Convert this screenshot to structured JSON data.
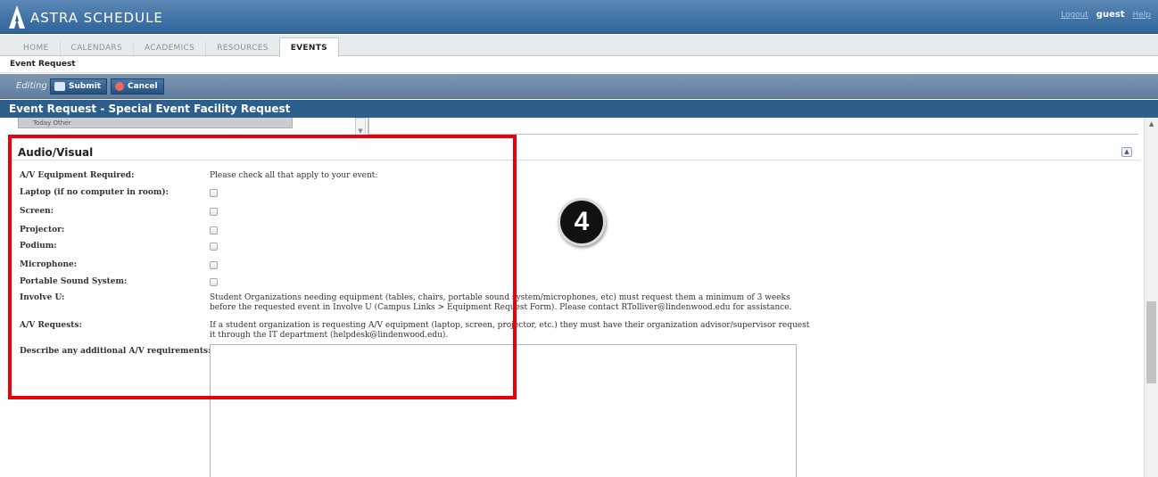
{
  "header": {
    "app_name": "ASTRA SCHEDULE",
    "logout": "Logout",
    "user": "guest",
    "help": "Help"
  },
  "nav": {
    "tabs": [
      "HOME",
      "CALENDARS",
      "ACADEMICS",
      "RESOURCES",
      "EVENTS"
    ],
    "active_tab": "EVENTS",
    "breadcrumb": "Event Request"
  },
  "toolbar": {
    "mode": "Editing",
    "submit_label": "Submit",
    "cancel_label": "Cancel"
  },
  "page_title": "Event Request - Special Event Facility Request",
  "remnant_buttons": "Today   Other",
  "section": {
    "title": "Audio/Visual",
    "collapse": "▲",
    "fields": [
      {
        "label": "A/V Equipment Required:",
        "text": "Please check all that apply to your event:"
      },
      {
        "label": "Laptop (if no computer in room):",
        "checkbox": true,
        "checked": false
      },
      {
        "label": "Screen:",
        "checkbox": true,
        "checked": false
      },
      {
        "label": "Projector:",
        "checkbox": true,
        "checked": false
      },
      {
        "label": "Podium:",
        "checkbox": true,
        "checked": false
      },
      {
        "label": "Microphone:",
        "checkbox": true,
        "checked": false
      },
      {
        "label": "Portable Sound System:",
        "checkbox": true,
        "checked": false
      },
      {
        "label": "Involve U:",
        "text_line1": "Student Organizations needing equipment (tables, chairs, portable sound system/microphones, etc) must request them a minimum of 3 weeks",
        "text_line2": "before the requested event in Involve U (Campus Links > Equipment Request Form). Please contact RTolliver@lindenwood.edu for assistance."
      },
      {
        "label": "A/V Requests:",
        "text_line1": "If a student organization is requesting A/V equipment (laptop, screen, projector, etc.) they must have their organization advisor/supervisor request",
        "text_line2": "it through the IT department (helpdesk@lindenwood.edu)."
      },
      {
        "label": "Describe any additional A/V requirements:",
        "textarea_value": ""
      }
    ]
  },
  "annotation": {
    "step_number": "4",
    "highlight_color": "#e8000b"
  }
}
